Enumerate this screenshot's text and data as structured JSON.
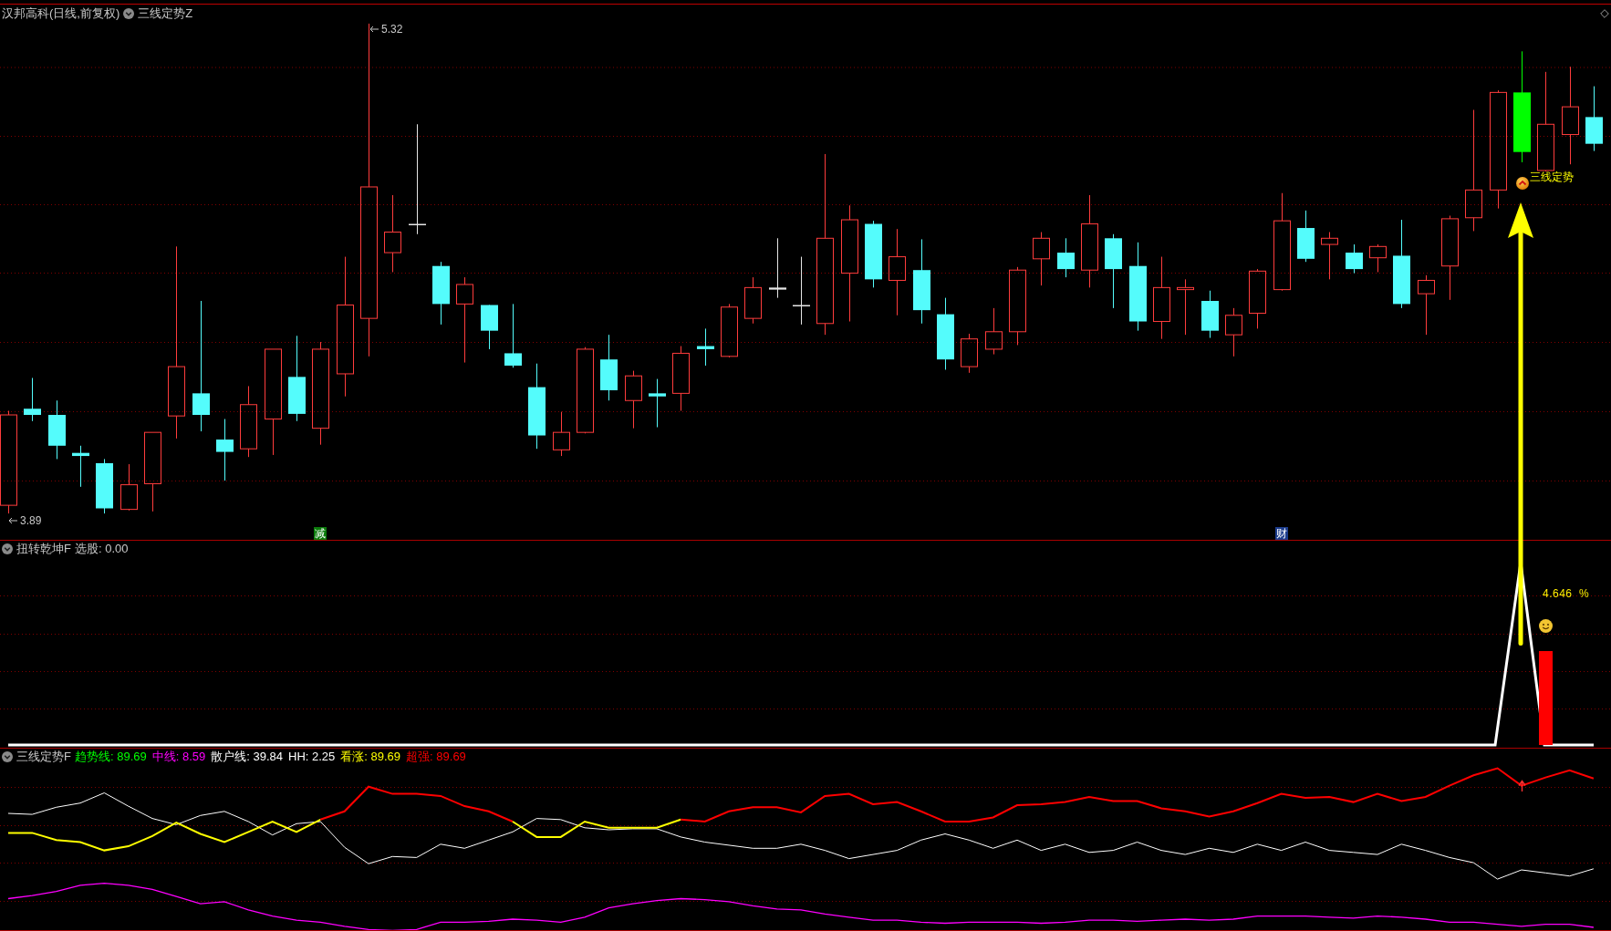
{
  "main_chart": {
    "title": "汉邦高科(日线,前复权)",
    "indicator": "三线定势Z",
    "high_price": "5.32",
    "low_price": "3.89",
    "signals": [
      {
        "text": "减",
        "color": "#0a7a0a"
      },
      {
        "text": "财",
        "color": "#1c3c8c"
      }
    ],
    "signal_caption": "三线定势"
  },
  "indicator_panel": {
    "title": "扭转乾坤F",
    "readout": "选股: 0.00",
    "peak_value": "4.646",
    "unit": "%"
  },
  "trend_panel": {
    "title": "三线定势F",
    "legend": [
      {
        "text": "趋势线: 89.69",
        "color": "#00ff00"
      },
      {
        "text": "中线: 8.59",
        "color": "#ff00ff"
      },
      {
        "text": "散户线: 39.84",
        "color": "#ffffff"
      },
      {
        "text": "HH: 2.25",
        "color": "#ffffff"
      },
      {
        "text": "看涨: 89.69",
        "color": "#ffff00"
      },
      {
        "text": "超强: 89.69",
        "color": "#ff0000"
      }
    ]
  }
}
